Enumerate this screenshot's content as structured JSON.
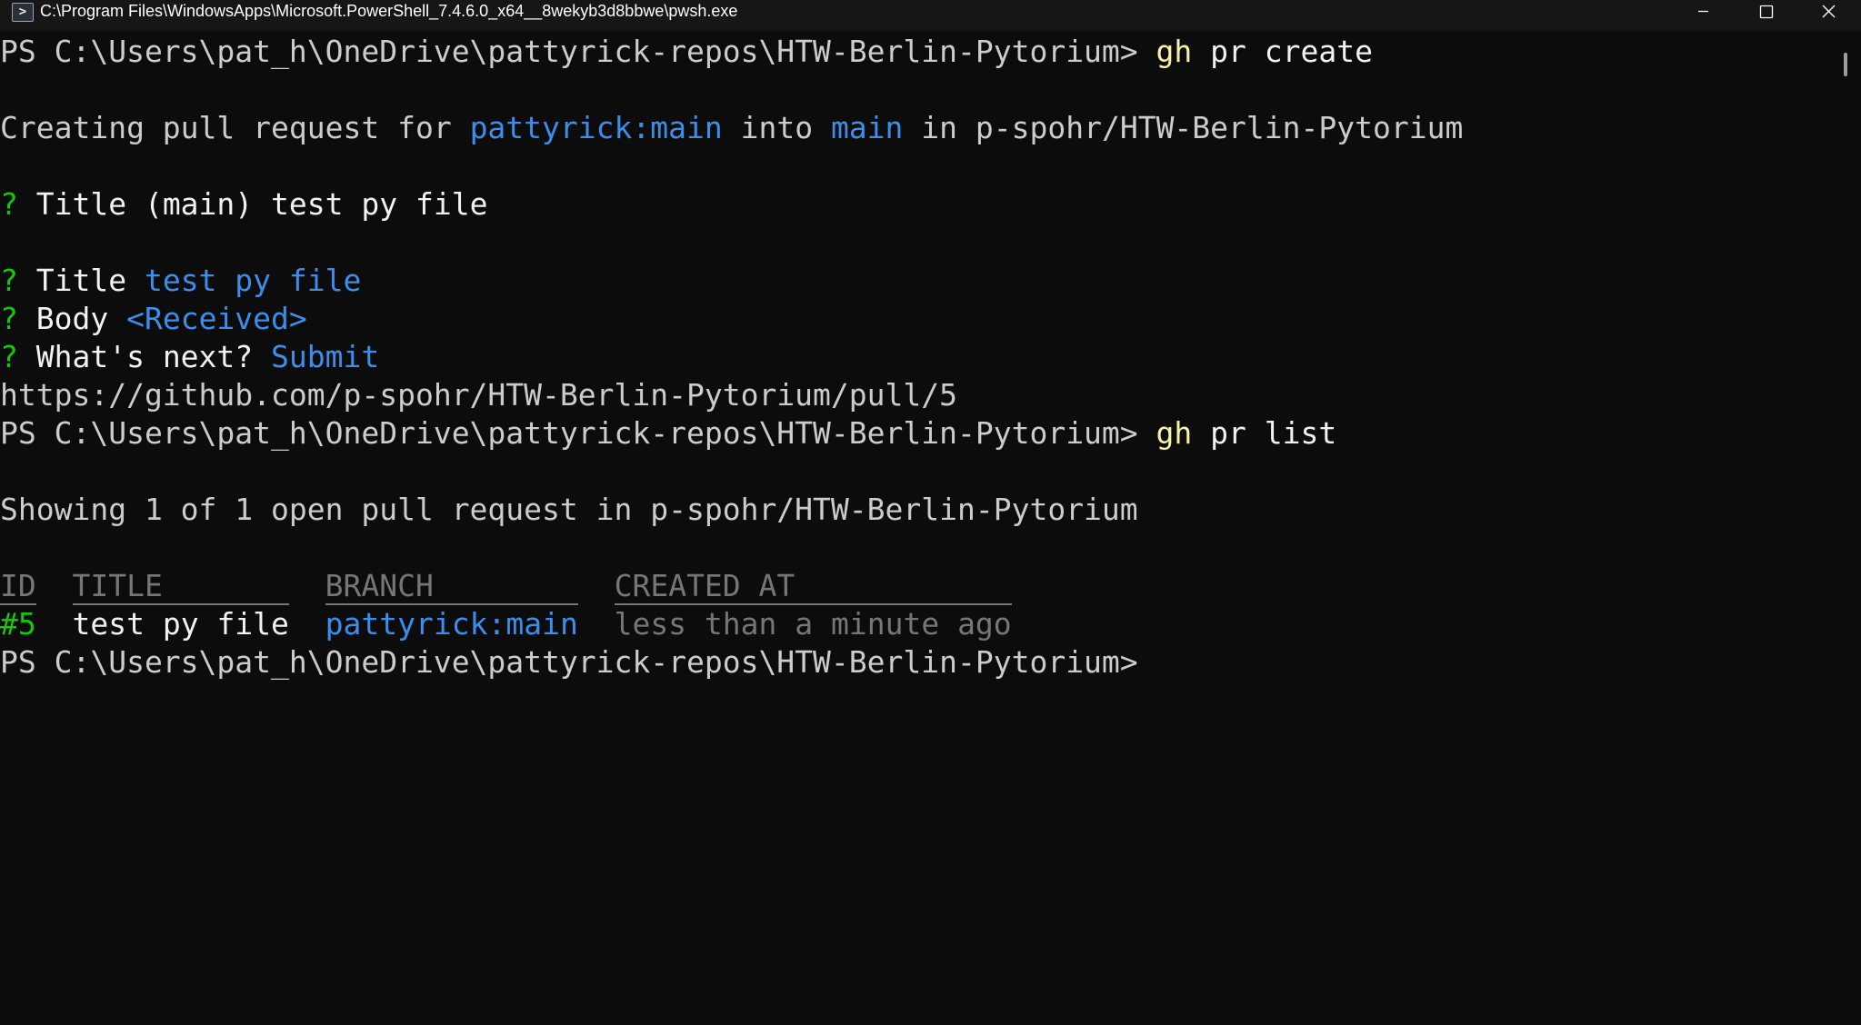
{
  "window": {
    "title": "C:\\Program Files\\WindowsApps\\Microsoft.PowerShell_7.4.6.0_x64__8wekyb3d8bbwe\\pwsh.exe",
    "icon": "powershell-icon",
    "controls": [
      "minimize-icon",
      "maximize-icon",
      "close-icon"
    ]
  },
  "colors": {
    "background": "#0c0c0c",
    "foreground": "#cccccc",
    "blue": "#3b8eea",
    "green": "#16c60c",
    "yellow": "#f9f1a5",
    "dim": "#767676"
  },
  "terminal": {
    "prompt": "PS C:\\Users\\pat_h\\OneDrive\\pattyrick-repos\\HTW-Berlin-Pytorium>",
    "cmd1": {
      "gh": "gh",
      "args": "pr create"
    },
    "creating": {
      "prefix": "Creating pull request for ",
      "head": "pattyrick:main",
      "into": " into ",
      "base": "main",
      "suffix": " in p-spohr/HTW-Berlin-Pytorium"
    },
    "q_mark": "?",
    "title_prompt": " Title (main) test py file",
    "title_answer": {
      "label": " Title ",
      "value": "test py file"
    },
    "body_answer": {
      "label": " Body ",
      "value": "<Received>"
    },
    "next_answer": {
      "label": " What's next? ",
      "value": "Submit"
    },
    "pr_url": "https://github.com/p-spohr/HTW-Berlin-Pytorium/pull/5",
    "cmd2": {
      "gh": "gh",
      "args": "pr list"
    },
    "showing": "Showing 1 of 1 open pull request in p-spohr/HTW-Berlin-Pytorium",
    "table": {
      "headers": {
        "id": "ID",
        "title": "TITLE",
        "branch": "BRANCH",
        "created": "CREATED AT"
      },
      "rows": [
        {
          "id": "#5",
          "title": "test py file",
          "branch": "pattyrick:main",
          "created": "less than a minute ago"
        }
      ]
    }
  }
}
